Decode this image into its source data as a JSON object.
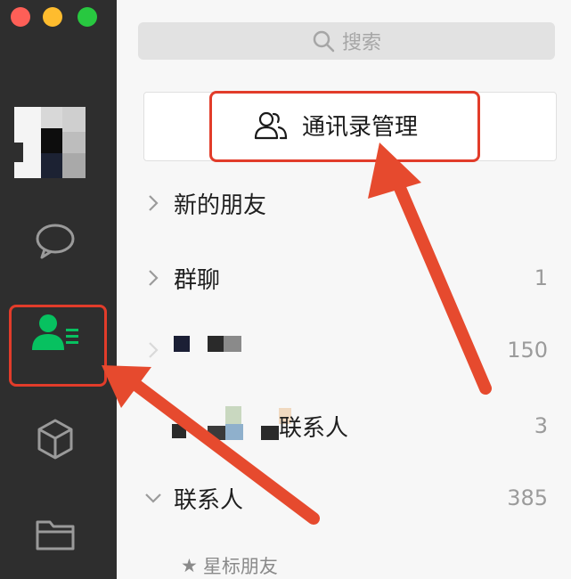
{
  "window": {
    "controls": [
      "close",
      "minimize",
      "zoom"
    ]
  },
  "sidebar": {
    "items": [
      {
        "icon": "chat-icon"
      },
      {
        "icon": "contacts-icon",
        "active": true
      },
      {
        "icon": "cube-icon"
      },
      {
        "icon": "folder-icon"
      }
    ]
  },
  "search": {
    "placeholder": "搜索"
  },
  "manage": {
    "label": "通讯录管理"
  },
  "list": {
    "new_friends": "新的朋友",
    "groups": "群聊",
    "groups_count": "1",
    "row3_count": "150",
    "row4_label": "联系人",
    "row4_count": "3",
    "contacts": "联系人",
    "contacts_count": "385",
    "starred": "星标朋友"
  },
  "colors": {
    "accent": "#07c160",
    "highlight": "#e23c2a",
    "sidebar": "#2e2e2e"
  }
}
